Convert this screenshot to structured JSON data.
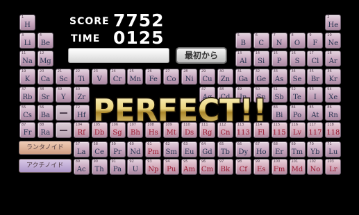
{
  "hud": {
    "score_label": "SCORE",
    "score_value": "7752",
    "time_label": "TIME",
    "time_value": "0125",
    "restart_label": "最初から",
    "answer_value": ""
  },
  "banner": {
    "text": "PERFECT!!"
  },
  "series_labels": {
    "lanthanoid": "ランタノイド",
    "actinoid": "アクチノイド"
  },
  "colors": {
    "tile": "#c4a2bb",
    "symbol": "#25334f",
    "symbol_new": "#9a1a30",
    "banner_gold": "#e9d27c"
  },
  "elements": [
    {
      "n": 1,
      "s": "H"
    },
    {
      "n": 2,
      "s": "He"
    },
    {
      "n": 3,
      "s": "Li"
    },
    {
      "n": 4,
      "s": "Be"
    },
    {
      "n": 5,
      "s": "B"
    },
    {
      "n": 6,
      "s": "C"
    },
    {
      "n": 7,
      "s": "N"
    },
    {
      "n": 8,
      "s": "O"
    },
    {
      "n": 9,
      "s": "F"
    },
    {
      "n": 10,
      "s": "Ne"
    },
    {
      "n": 11,
      "s": "Na"
    },
    {
      "n": 12,
      "s": "Mg"
    },
    {
      "n": 13,
      "s": "Al"
    },
    {
      "n": 14,
      "s": "Si"
    },
    {
      "n": 15,
      "s": "P"
    },
    {
      "n": 16,
      "s": "S"
    },
    {
      "n": 17,
      "s": "Cl"
    },
    {
      "n": 18,
      "s": "Ar"
    },
    {
      "n": 19,
      "s": "K"
    },
    {
      "n": 20,
      "s": "Ca"
    },
    {
      "n": 21,
      "s": "Sc"
    },
    {
      "n": 22,
      "s": "Ti"
    },
    {
      "n": 23,
      "s": "V"
    },
    {
      "n": 24,
      "s": "Cr"
    },
    {
      "n": 25,
      "s": "Mn"
    },
    {
      "n": 26,
      "s": "Fe"
    },
    {
      "n": 27,
      "s": "Co"
    },
    {
      "n": 28,
      "s": "Ni"
    },
    {
      "n": 29,
      "s": "Cu"
    },
    {
      "n": 30,
      "s": "Zn"
    },
    {
      "n": 31,
      "s": "Ga"
    },
    {
      "n": 32,
      "s": "Ge"
    },
    {
      "n": 33,
      "s": "As"
    },
    {
      "n": 34,
      "s": "Se"
    },
    {
      "n": 35,
      "s": "Br"
    },
    {
      "n": 36,
      "s": "Kr"
    },
    {
      "n": 37,
      "s": "Rb"
    },
    {
      "n": 38,
      "s": "Sr"
    },
    {
      "n": 39,
      "s": "Y"
    },
    {
      "n": 40,
      "s": "Zr"
    },
    {
      "n": 47,
      "s": "Ag"
    },
    {
      "n": 48,
      "s": "Cd"
    },
    {
      "n": 49,
      "s": "In"
    },
    {
      "n": 50,
      "s": "Sn"
    },
    {
      "n": 51,
      "s": "Sb"
    },
    {
      "n": 52,
      "s": "Te"
    },
    {
      "n": 53,
      "s": "I"
    },
    {
      "n": 54,
      "s": "Xe"
    },
    {
      "n": 55,
      "s": "Cs"
    },
    {
      "n": 56,
      "s": "Ba"
    },
    {
      "n": 72,
      "s": "Hf"
    },
    {
      "n": 83,
      "s": "Bi"
    },
    {
      "n": 84,
      "s": "Po"
    },
    {
      "n": 85,
      "s": "At"
    },
    {
      "n": 86,
      "s": "Rn"
    },
    {
      "n": 87,
      "s": "Fr"
    },
    {
      "n": 88,
      "s": "Ra"
    },
    {
      "n": 104,
      "s": "Rf"
    },
    {
      "n": 105,
      "s": "Db"
    },
    {
      "n": 106,
      "s": "Sg"
    },
    {
      "n": 107,
      "s": "Bh"
    },
    {
      "n": 108,
      "s": "Hs"
    },
    {
      "n": 109,
      "s": "Mt"
    },
    {
      "n": 110,
      "s": "Ds"
    },
    {
      "n": 111,
      "s": "Rg"
    },
    {
      "n": 112,
      "s": "Cn"
    },
    {
      "n": 113,
      "s": "113"
    },
    {
      "n": 114,
      "s": "Fl"
    },
    {
      "n": 115,
      "s": "115"
    },
    {
      "n": 116,
      "s": "Lv"
    },
    {
      "n": 117,
      "s": "117"
    },
    {
      "n": 118,
      "s": "118"
    },
    {
      "n": 57,
      "s": "La"
    },
    {
      "n": 58,
      "s": "Ce"
    },
    {
      "n": 59,
      "s": "Pr"
    },
    {
      "n": 60,
      "s": "Nd"
    },
    {
      "n": 61,
      "s": "Pm"
    },
    {
      "n": 62,
      "s": "Sm"
    },
    {
      "n": 63,
      "s": "Eu"
    },
    {
      "n": 64,
      "s": "Gd"
    },
    {
      "n": 65,
      "s": "Tb"
    },
    {
      "n": 66,
      "s": "Dy"
    },
    {
      "n": 67,
      "s": "Ho"
    },
    {
      "n": 68,
      "s": "Er"
    },
    {
      "n": 69,
      "s": "Tm"
    },
    {
      "n": 70,
      "s": "Yb"
    },
    {
      "n": 71,
      "s": "Lu"
    },
    {
      "n": 89,
      "s": "Ac"
    },
    {
      "n": 90,
      "s": "Th"
    },
    {
      "n": 91,
      "s": "Pa"
    },
    {
      "n": 92,
      "s": "U"
    },
    {
      "n": 93,
      "s": "Np"
    },
    {
      "n": 94,
      "s": "Pu"
    },
    {
      "n": 95,
      "s": "Am"
    },
    {
      "n": 96,
      "s": "Cm"
    },
    {
      "n": 97,
      "s": "Bk"
    },
    {
      "n": 98,
      "s": "Cf"
    },
    {
      "n": 99,
      "s": "Es"
    },
    {
      "n": 100,
      "s": "Fm"
    },
    {
      "n": 101,
      "s": "Md"
    },
    {
      "n": 102,
      "s": "No"
    },
    {
      "n": 103,
      "s": "Lr"
    }
  ]
}
